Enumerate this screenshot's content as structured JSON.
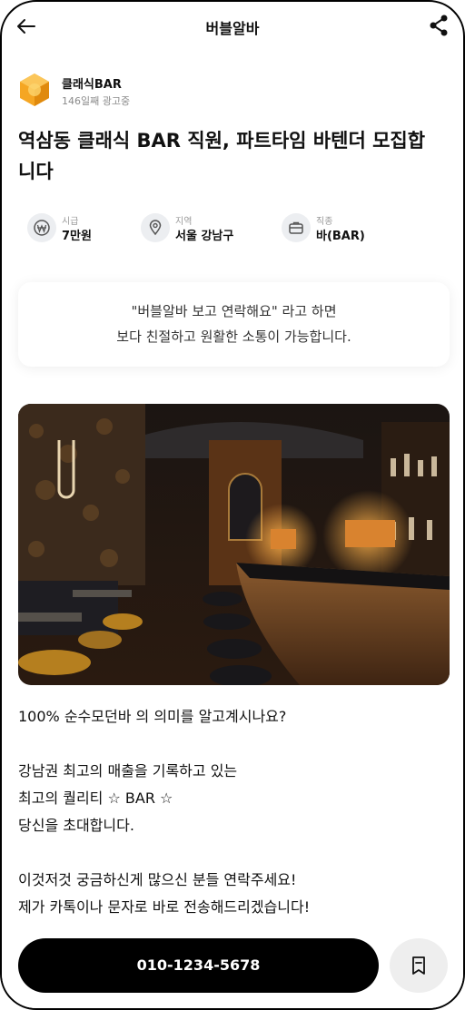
{
  "header": {
    "title": "버블알바"
  },
  "company": {
    "name": "클래식BAR",
    "meta": "146일째 광고중"
  },
  "post": {
    "headline_line1": "역삼동 클래식 BAR 직원, 파트타임 바텐더 모집합",
    "headline_line2": "니다"
  },
  "info": [
    {
      "label": "시급",
      "value": "7만원",
      "icon": "won-icon"
    },
    {
      "label": "지역",
      "value": "서울 강남구",
      "icon": "location-pin-icon"
    },
    {
      "label": "직종",
      "value": "바(BAR)",
      "icon": "briefcase-icon"
    }
  ],
  "notice": {
    "line1": "\"버블알바 보고 연락해요\" 라고 하면",
    "line2": "보다 친절하고 원활한 소통이 가능합니다."
  },
  "description": [
    "100% 순수모던바 의 의미를 알고계시나요?",
    "",
    "강남권 최고의 매출을 기록하고 있는",
    "최고의 퀄리티 ☆ BAR ☆",
    "당신을 초대합니다.",
    "",
    "이것저것 궁금하신게 많으신 분들 연락주세요!",
    "제가 카톡이나 문자로 바로 전송해드리겠습니다!"
  ],
  "bottom": {
    "phone": "010-1234-5678"
  },
  "colors": {
    "accent": "#000000",
    "logo": "#f5a623"
  }
}
